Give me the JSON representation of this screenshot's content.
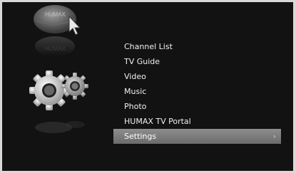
{
  "logo_text": "HUMAX",
  "menu": {
    "items": [
      {
        "label": "Channel List"
      },
      {
        "label": "TV Guide"
      },
      {
        "label": "Video"
      },
      {
        "label": "Music"
      },
      {
        "label": "Photo"
      },
      {
        "label": "HUMAX TV Portal"
      },
      {
        "label": "Settings",
        "selected": true,
        "chevron": "›"
      }
    ]
  },
  "colors": {
    "background": "#121212",
    "frame": "#d8d8d8",
    "highlight": "#7c7c7c",
    "text": "#f0f0f0"
  },
  "icons": [
    "globe-icon",
    "cursor-icon",
    "gear-icon"
  ]
}
